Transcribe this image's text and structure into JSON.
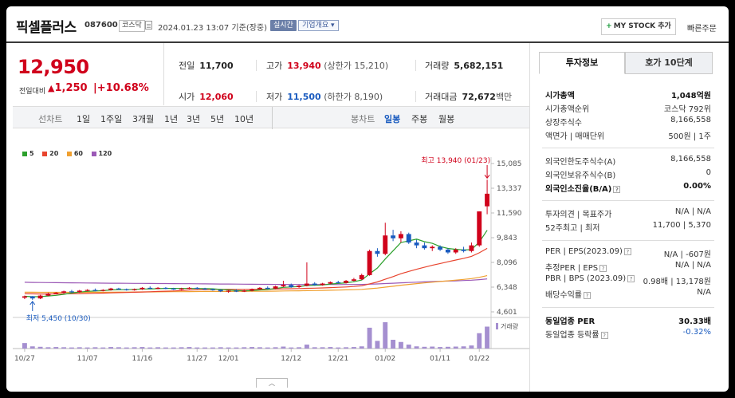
{
  "header": {
    "name": "픽셀플러스",
    "code": "087600",
    "market": "코스닥",
    "timestamp": "2024.01.23 13:07  기준(장중)",
    "realtime": "실시간",
    "company_info": "기업개요 ▾",
    "mystock": "MY STOCK 추가",
    "quick_order": "빠른주문"
  },
  "price": {
    "current": "12,950",
    "change_label": "전일대비",
    "change": "1,250",
    "change_pct": "+10.68%"
  },
  "quotes": {
    "prev_label": "전일",
    "prev": "11,700",
    "high_label": "고가",
    "high": "13,940",
    "high_note": "(상한가 15,210)",
    "volume_label": "거래량",
    "volume": "5,682,151",
    "open_label": "시가",
    "open": "12,060",
    "low_label": "저가",
    "low": "11,500",
    "low_note": "(하한가 8,190)",
    "amount_label": "거래대금",
    "amount": "72,672",
    "amount_unit": "백만"
  },
  "period_tabs": {
    "line_label": "선차트",
    "items": [
      "1일",
      "1주일",
      "3개월",
      "1년",
      "3년",
      "5년",
      "10년"
    ],
    "candle_label": "봉차트",
    "candle_items": [
      "일봉",
      "주봉",
      "월봉"
    ],
    "active_candle": "일봉"
  },
  "colors": {
    "up": "#d0021b",
    "down": "#1a5bbf",
    "ma5": "#2ca02c",
    "ma20": "#e8442e",
    "ma60": "#f0a030",
    "ma120": "#9b59b6"
  },
  "chart_data": {
    "type": "candlestick",
    "legend": [
      "5",
      "20",
      "60",
      "120"
    ],
    "y_ticks": [
      15085,
      13337,
      11590,
      9843,
      8096,
      6348,
      4601
    ],
    "y_tick_labels": [
      "15,085",
      "13,337",
      "11,590",
      "9,843",
      "8,096",
      "6,348",
      "4,601"
    ],
    "ylim": [
      4601,
      15085
    ],
    "x_tick_labels": [
      "10/27",
      "11/07",
      "11/16",
      "11/27",
      "12/01",
      "12/12",
      "12/21",
      "01/02",
      "01/11",
      "01/22"
    ],
    "max_label": "최고 13,940 (01/23)",
    "min_label": "최저 5,450 (10/30)",
    "volume_label": "거래량",
    "candles": [
      {
        "o": 5600,
        "h": 5750,
        "l": 5500,
        "c": 5700
      },
      {
        "o": 5700,
        "h": 5720,
        "l": 5450,
        "c": 5550
      },
      {
        "o": 5550,
        "h": 5800,
        "l": 5500,
        "c": 5750
      },
      {
        "o": 5750,
        "h": 5950,
        "l": 5700,
        "c": 5900
      },
      {
        "o": 5900,
        "h": 6000,
        "l": 5850,
        "c": 5950
      },
      {
        "o": 5950,
        "h": 6100,
        "l": 5900,
        "c": 6050
      },
      {
        "o": 6050,
        "h": 6150,
        "l": 5950,
        "c": 6000
      },
      {
        "o": 6000,
        "h": 6150,
        "l": 5950,
        "c": 6100
      },
      {
        "o": 6100,
        "h": 6200,
        "l": 6050,
        "c": 6150
      },
      {
        "o": 6150,
        "h": 6250,
        "l": 6050,
        "c": 6100
      },
      {
        "o": 6100,
        "h": 6200,
        "l": 6050,
        "c": 6150
      },
      {
        "o": 6150,
        "h": 6300,
        "l": 6100,
        "c": 6250
      },
      {
        "o": 6250,
        "h": 6300,
        "l": 6150,
        "c": 6200
      },
      {
        "o": 6200,
        "h": 6250,
        "l": 6100,
        "c": 6150
      },
      {
        "o": 6150,
        "h": 6250,
        "l": 6100,
        "c": 6200
      },
      {
        "o": 6200,
        "h": 6350,
        "l": 6150,
        "c": 6300
      },
      {
        "o": 6300,
        "h": 6400,
        "l": 6200,
        "c": 6250
      },
      {
        "o": 6250,
        "h": 6350,
        "l": 6200,
        "c": 6300
      },
      {
        "o": 6300,
        "h": 6350,
        "l": 6200,
        "c": 6250
      },
      {
        "o": 6250,
        "h": 6300,
        "l": 6150,
        "c": 6200
      },
      {
        "o": 6200,
        "h": 6300,
        "l": 6150,
        "c": 6250
      },
      {
        "o": 6250,
        "h": 6350,
        "l": 6200,
        "c": 6300
      },
      {
        "o": 6300,
        "h": 6350,
        "l": 6200,
        "c": 6250
      },
      {
        "o": 6250,
        "h": 6300,
        "l": 6150,
        "c": 6200
      },
      {
        "o": 6200,
        "h": 6250,
        "l": 6100,
        "c": 6150
      },
      {
        "o": 6150,
        "h": 6200,
        "l": 6000,
        "c": 6050
      },
      {
        "o": 6050,
        "h": 6150,
        "l": 5950,
        "c": 6100
      },
      {
        "o": 6100,
        "h": 6200,
        "l": 6000,
        "c": 6050
      },
      {
        "o": 6050,
        "h": 6150,
        "l": 6000,
        "c": 6100
      },
      {
        "o": 6100,
        "h": 6250,
        "l": 6050,
        "c": 6200
      },
      {
        "o": 6200,
        "h": 6350,
        "l": 6150,
        "c": 6300
      },
      {
        "o": 6300,
        "h": 6400,
        "l": 6200,
        "c": 6250
      },
      {
        "o": 6250,
        "h": 6450,
        "l": 6200,
        "c": 6400
      },
      {
        "o": 6400,
        "h": 6800,
        "l": 6350,
        "c": 6500
      },
      {
        "o": 6500,
        "h": 6600,
        "l": 6300,
        "c": 6350
      },
      {
        "o": 6350,
        "h": 6500,
        "l": 6300,
        "c": 6450
      },
      {
        "o": 6450,
        "h": 8100,
        "l": 6400,
        "c": 6600
      },
      {
        "o": 6600,
        "h": 6700,
        "l": 6450,
        "c": 6500
      },
      {
        "o": 6500,
        "h": 6650,
        "l": 6450,
        "c": 6600
      },
      {
        "o": 6600,
        "h": 6750,
        "l": 6550,
        "c": 6700
      },
      {
        "o": 6700,
        "h": 6800,
        "l": 6600,
        "c": 6650
      },
      {
        "o": 6650,
        "h": 6850,
        "l": 6600,
        "c": 6800
      },
      {
        "o": 6800,
        "h": 7000,
        "l": 6750,
        "c": 6900
      },
      {
        "o": 6900,
        "h": 7300,
        "l": 6850,
        "c": 7200
      },
      {
        "o": 7200,
        "h": 9000,
        "l": 7150,
        "c": 8900
      },
      {
        "o": 8900,
        "h": 9100,
        "l": 8500,
        "c": 8700
      },
      {
        "o": 8700,
        "h": 10900,
        "l": 8600,
        "c": 10000
      },
      {
        "o": 10000,
        "h": 10400,
        "l": 9600,
        "c": 9800
      },
      {
        "o": 9800,
        "h": 10300,
        "l": 9500,
        "c": 10100
      },
      {
        "o": 10100,
        "h": 10200,
        "l": 9400,
        "c": 9500
      },
      {
        "o": 9500,
        "h": 9700,
        "l": 9100,
        "c": 9300
      },
      {
        "o": 9300,
        "h": 9500,
        "l": 9000,
        "c": 9100
      },
      {
        "o": 9100,
        "h": 9300,
        "l": 8900,
        "c": 9200
      },
      {
        "o": 9200,
        "h": 9300,
        "l": 8900,
        "c": 9000
      },
      {
        "o": 9000,
        "h": 9100,
        "l": 8700,
        "c": 8800
      },
      {
        "o": 8800,
        "h": 9100,
        "l": 8700,
        "c": 9000
      },
      {
        "o": 9000,
        "h": 9200,
        "l": 8800,
        "c": 8900
      },
      {
        "o": 8900,
        "h": 9500,
        "l": 8800,
        "c": 9300
      },
      {
        "o": 9300,
        "h": 11700,
        "l": 9200,
        "c": 11700
      },
      {
        "o": 12060,
        "h": 13940,
        "l": 11500,
        "c": 12950
      }
    ],
    "volumes": [
      25,
      10,
      8,
      6,
      7,
      6,
      5,
      6,
      5,
      6,
      5,
      7,
      6,
      5,
      6,
      7,
      5,
      6,
      5,
      5,
      6,
      7,
      5,
      5,
      5,
      6,
      5,
      5,
      6,
      7,
      6,
      5,
      6,
      9,
      5,
      6,
      18,
      6,
      6,
      7,
      5,
      6,
      7,
      10,
      95,
      35,
      120,
      40,
      30,
      18,
      10,
      8,
      9,
      7,
      8,
      9,
      10,
      14,
      70,
      100
    ]
  },
  "right_panel": {
    "tab_active": "투자정보",
    "tab_other": "호가 10단계",
    "rows1": [
      {
        "k": "시가총액",
        "v": "1,048억원",
        "bold": true
      },
      {
        "k": "시가총액순위",
        "v": "코스닥 792위"
      },
      {
        "k": "상장주식수",
        "v": "8,166,558"
      },
      {
        "k": "액면가 | 매매단위",
        "v": "500원 | 1주"
      }
    ],
    "rows2": [
      {
        "k": "외국인한도주식수(A)",
        "v": "8,166,558"
      },
      {
        "k": "외국인보유주식수(B)",
        "v": "0"
      },
      {
        "k": "외국인소진율(B/A)",
        "v": "0.00%",
        "bold": true
      }
    ],
    "rows3": [
      {
        "k": "투자의견 | 목표주가",
        "v": "N/A | N/A"
      },
      {
        "k": "52주최고 | 최저",
        "v": "11,700 | 5,370"
      }
    ],
    "rows4": [
      {
        "k": "PER | EPS(2023.09)",
        "v": "N/A | -607원"
      },
      {
        "k": "추정PER | EPS",
        "v": "N/A | N/A"
      },
      {
        "k": "PBR | BPS (2023.09)",
        "v": "0.98배 | 13,178원"
      },
      {
        "k": "배당수익률",
        "v": "N/A"
      }
    ],
    "rows5": [
      {
        "k": "동일업종 PER",
        "v": "30.33배",
        "bold": true
      },
      {
        "k": "동일업종 등락률",
        "v": "-0.32%"
      }
    ]
  }
}
